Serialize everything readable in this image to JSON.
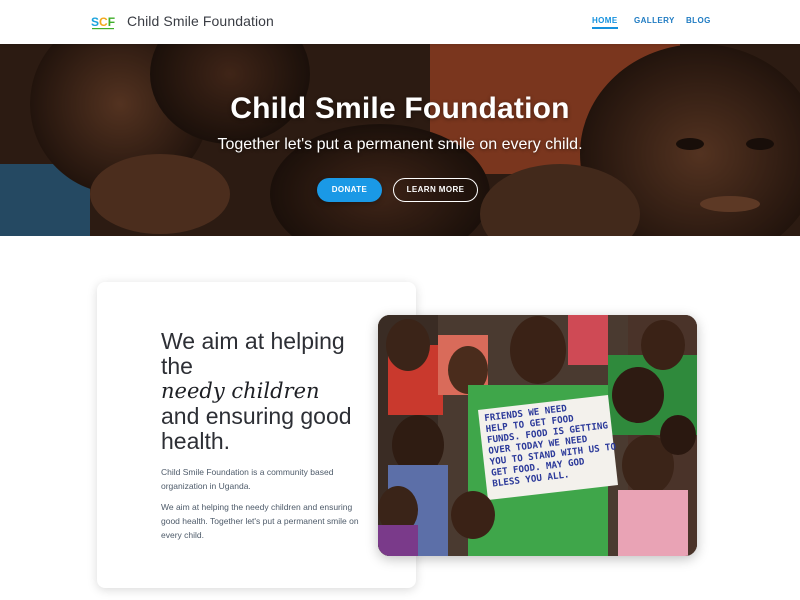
{
  "brand": {
    "logo_text": "SCF",
    "name": "Child Smile Foundation"
  },
  "nav": {
    "items": [
      {
        "label": "HOME",
        "active": true
      },
      {
        "label": "GALLERY",
        "active": false
      },
      {
        "label": "BLOG",
        "active": false
      }
    ]
  },
  "hero": {
    "title": "Child Smile Foundation",
    "subtitle": "Together let's put a permanent smile on every child.",
    "donate_label": "DONATE",
    "learn_label": "LEARN MORE"
  },
  "about": {
    "heading_line1": "We aim at helping",
    "heading_line2": "the",
    "heading_emphasis": "needy children",
    "heading_line3": "and ensuring good",
    "heading_line4": "health.",
    "paragraph1": "Child Smile Foundation is a community based organization in Uganda.",
    "paragraph2": "We aim at helping the needy children and ensuring good health. Together let's put a permanent smile on every child."
  },
  "photo": {
    "sign_text": "FRIENDS WE NEED\nHELP TO GET FOOD\nFUNDS. FOOD IS GETTING\nOVER TODAY WE NEED\nYOU TO STAND WITH US TO\nGET FOOD. MAY GOD\nBLESS YOU ALL."
  },
  "colors": {
    "accent": "#1a99e6",
    "nav_link": "#1f7bc2",
    "logo_s": "#1aa3dd",
    "logo_c": "#f2a81d",
    "logo_f": "#3fae2a"
  }
}
